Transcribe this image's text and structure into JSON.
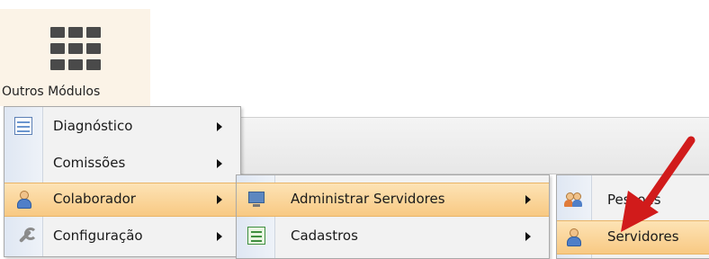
{
  "launcher": {
    "label": "Outros Módulos",
    "icon": "grid-icon"
  },
  "menu1": {
    "items": [
      {
        "label": "Diagnóstico",
        "icon": "table-icon",
        "has_submenu": true
      },
      {
        "label": "Comissões",
        "icon": "",
        "has_submenu": true
      },
      {
        "label": "Colaborador",
        "icon": "user-icon",
        "has_submenu": true,
        "active": true
      },
      {
        "label": "Configuração",
        "icon": "wrench-icon",
        "has_submenu": true
      }
    ]
  },
  "menu2": {
    "items": [
      {
        "label": "Administrar Servidores",
        "icon": "monitor-icon",
        "has_submenu": true,
        "active": true
      },
      {
        "label": "Cadastros",
        "icon": "form-icon",
        "has_submenu": true
      }
    ]
  },
  "menu3": {
    "items": [
      {
        "label": "Pessoas",
        "icon": "people-icon"
      },
      {
        "label": "Servidores",
        "icon": "user-icon",
        "active": true
      }
    ]
  },
  "annotation": {
    "arrow_color": "#d11b1b"
  },
  "colors": {
    "active_bg": "#f8c983",
    "menu_bg": "#f2f2f2",
    "gutter": "#dfe7f3"
  }
}
